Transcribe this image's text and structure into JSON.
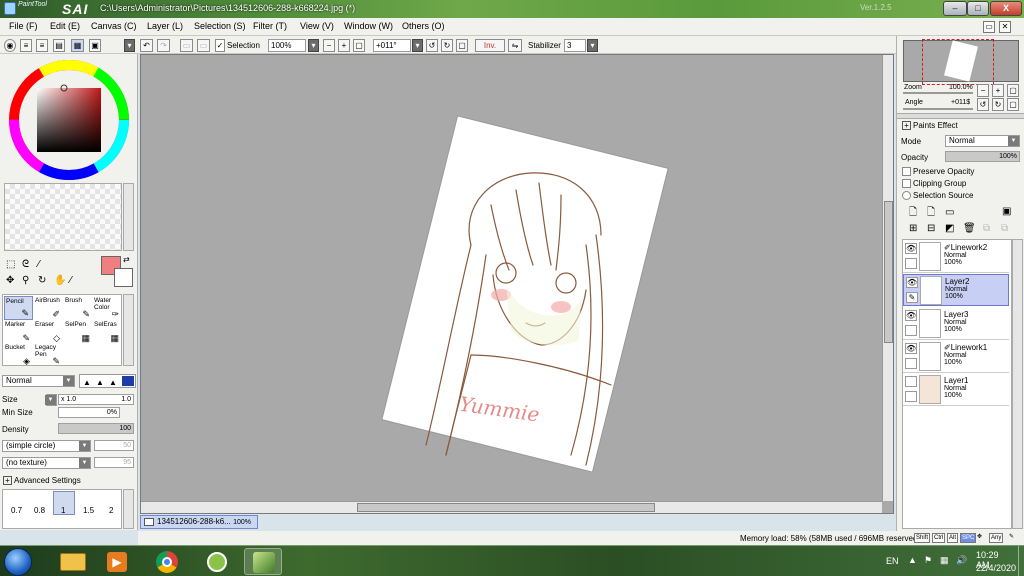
{
  "titlebar": {
    "app_small": "PaintTool",
    "app_big": "SAI",
    "path": "C:\\Users\\Administrator\\Pictures\\134512606-288-k668224.jpg (*)",
    "version": "Ver.1.2.5",
    "min": "–",
    "max": "□",
    "close": "X"
  },
  "menu": [
    "File (F)",
    "Edit (E)",
    "Canvas (C)",
    "Layer (L)",
    "Selection (S)",
    "Filter (T)",
    "View (V)",
    "Window (W)",
    "Others (O)"
  ],
  "toolbar": {
    "selection_label": "Selection",
    "zoom": "100%",
    "angle": "+011°",
    "inv": "Inv.",
    "stabilizer_label": "Stabilizer",
    "stabilizer_value": "3"
  },
  "tools": {
    "items": [
      {
        "label": "Pencil",
        "icon": "pencil-icon",
        "active": true
      },
      {
        "label": "AirBrush",
        "icon": "airbrush-icon"
      },
      {
        "label": "Brush",
        "icon": "brush-icon"
      },
      {
        "label": "Water Color",
        "icon": "watercolor-icon"
      },
      {
        "label": "Marker",
        "icon": "marker-icon"
      },
      {
        "label": "Eraser",
        "icon": "eraser-icon"
      },
      {
        "label": "SelPen",
        "icon": "selpen-icon"
      },
      {
        "label": "SelEras",
        "icon": "seleras-icon"
      },
      {
        "label": "Bucket",
        "icon": "bucket-icon"
      },
      {
        "label": "Legacy Pen",
        "icon": "legacy-pen-icon"
      }
    ]
  },
  "brush": {
    "mode": "Normal",
    "size_label": "Size",
    "size_mult": "x 1.0",
    "size_value": "1.0",
    "min_size_label": "Min Size",
    "min_size_value": "0%",
    "density_label": "Density",
    "density_value": "100",
    "shape": "(simple circle)",
    "shape_value": "50",
    "texture": "(no texture)",
    "texture_value": "95",
    "advanced": "Advanced Settings",
    "presets": [
      "0.7",
      "0.8",
      "1",
      "1.5",
      "2"
    ],
    "primary_color": "#f08080"
  },
  "canvas": {
    "doc_tab": "134512606-288-k6...",
    "doc_zoom": "100%",
    "text_on_paper": "Yummie"
  },
  "status": {
    "memory": "Memory load: 58% (58MB used / 696MB reserved)",
    "keys": [
      "Shift",
      "Ctrl",
      "Alt",
      "SPC",
      "Any"
    ]
  },
  "right": {
    "zoom_label": "Zoom",
    "zoom_value": "100.0%",
    "angle_label": "Angle",
    "angle_value": "+011$",
    "paints_effect": "Paints Effect",
    "mode_label": "Mode",
    "mode_value": "Normal",
    "opacity_label": "Opacity",
    "opacity_value": "100%",
    "preserve_opacity": "Preserve Opacity",
    "clipping_group": "Clipping Group",
    "selection_source": "Selection Source",
    "layers": [
      {
        "name": "Linework2",
        "mode": "Normal",
        "opacity": "100%",
        "linework": true
      },
      {
        "name": "Layer2",
        "mode": "Normal",
        "opacity": "100%",
        "active": true
      },
      {
        "name": "Layer3",
        "mode": "Normal",
        "opacity": "100%"
      },
      {
        "name": "Linework1",
        "mode": "Normal",
        "opacity": "100%",
        "linework": true
      },
      {
        "name": "Layer1",
        "mode": "Normal",
        "opacity": "100%"
      }
    ]
  },
  "taskbar": {
    "lang": "EN",
    "time": "10:29 AM",
    "date": "22/4/2020"
  }
}
